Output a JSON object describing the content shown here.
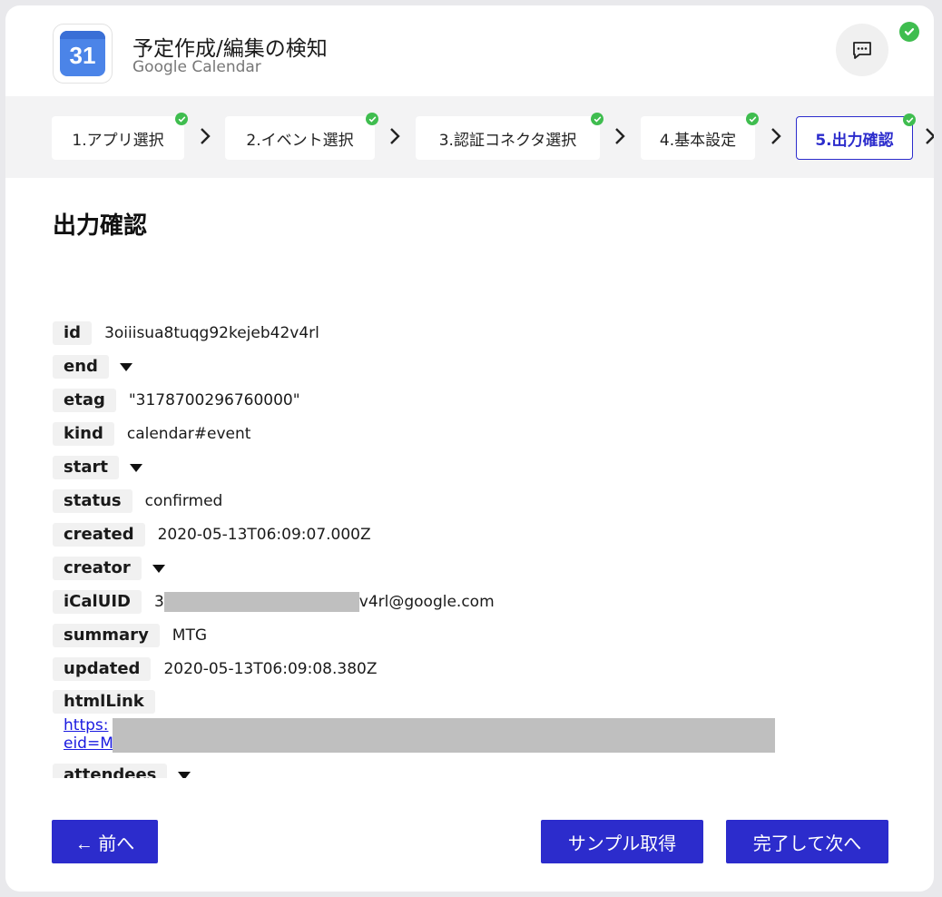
{
  "header": {
    "app_icon_text": "31",
    "title": "予定作成/編集の検知",
    "subtitle": "Google Calendar"
  },
  "steps": [
    {
      "label": "1.アプリ選択",
      "done": true
    },
    {
      "label": "2.イベント選択",
      "done": true
    },
    {
      "label": "3.認証コネクタ選択",
      "done": true
    },
    {
      "label": "4.基本設定",
      "done": true
    },
    {
      "label": "5.出力確認",
      "done": true,
      "active": true
    }
  ],
  "main": {
    "section_title": "出力確認",
    "fields": {
      "id": {
        "key": "id",
        "value": "3oiiisua8tuqg92kejeb42v4rl"
      },
      "end": {
        "key": "end"
      },
      "etag": {
        "key": "etag",
        "value": "\"3178700296760000\""
      },
      "kind": {
        "key": "kind",
        "value": "calendar#event"
      },
      "start": {
        "key": "start"
      },
      "status": {
        "key": "status",
        "value": "confirmed"
      },
      "created": {
        "key": "created",
        "value": "2020-05-13T06:09:07.000Z"
      },
      "creator": {
        "key": "creator"
      },
      "icaluid": {
        "key": "iCalUID",
        "value_prefix": "3",
        "value_suffix": "v4rl@google.com"
      },
      "summary": {
        "key": "summary",
        "value": "MTG"
      },
      "updated": {
        "key": "updated",
        "value": "2020-05-13T06:09:08.380Z"
      },
      "htmllink": {
        "key": "htmlLink",
        "line1_prefix": "https:",
        "line2_prefix": "eid=M"
      },
      "attendees": {
        "key": "attendees"
      }
    }
  },
  "footer": {
    "back_label": "← 前へ",
    "sample_label": "サンプル取得",
    "next_label": "完了して次へ"
  },
  "colors": {
    "accent": "#2c2ccc",
    "success": "#3fbd4f",
    "redaction": "#bfbfbf"
  }
}
